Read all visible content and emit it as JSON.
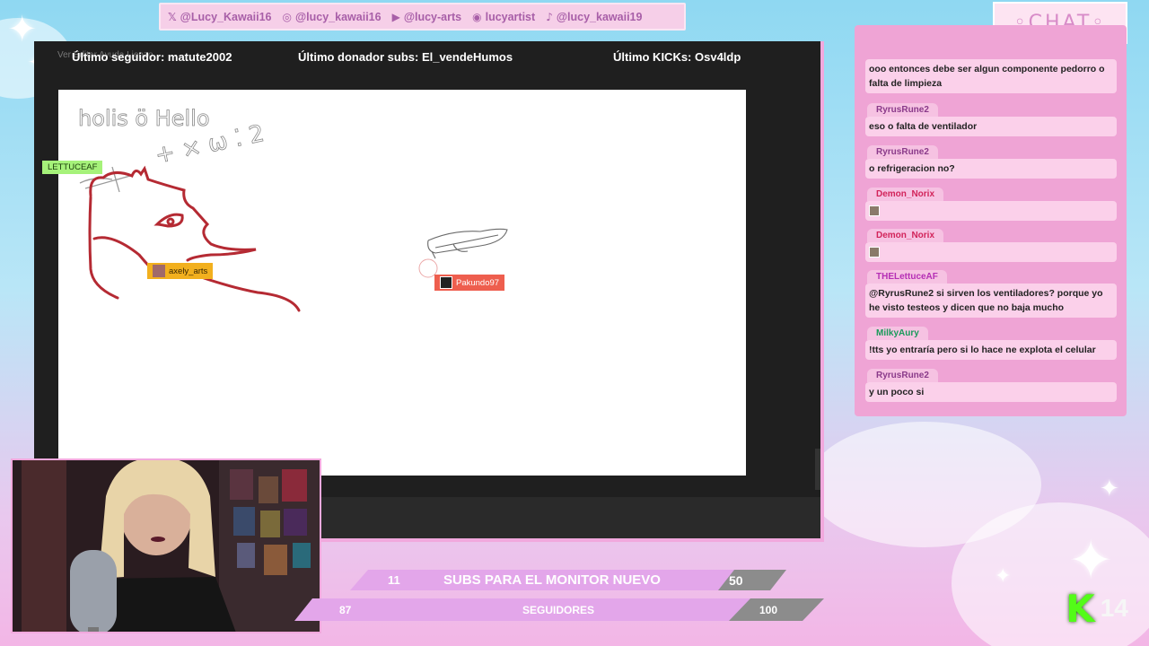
{
  "social": [
    {
      "icon": "x-icon",
      "glyph": "𝕏",
      "label": "@Lucy_Kawaii16"
    },
    {
      "icon": "instagram-icon",
      "glyph": "◎",
      "label": "@lucy_kawaii16"
    },
    {
      "icon": "youtube-icon",
      "glyph": "▶",
      "label": "@lucy-arts"
    },
    {
      "icon": "discord-icon",
      "glyph": "◉",
      "label": "lucyartist"
    },
    {
      "icon": "tiktok-icon",
      "glyph": "♪",
      "label": "@lucy_kawaii19"
    }
  ],
  "topbar": {
    "ghost_menu": "Ver   Editar   Ayuda   Lienzo",
    "follower": "Último seguidor: matute2002",
    "donor": "Último donador subs: El_vendeHumos",
    "kicks": "Último KICKs: Osv4ldp"
  },
  "canvas": {
    "handwriting_1": "holis ö   Hello",
    "handwriting_2": "+ × ω ⁚ 2",
    "cursors": [
      {
        "name": "LETTUCEAF",
        "color": "#a6f27a",
        "text_color": "#1a3d0a"
      },
      {
        "name": "axely_arts",
        "color": "#f2b01e",
        "text_color": "#3a2600"
      },
      {
        "name": "Pakundo97",
        "color": "#ee5e4e",
        "text_color": "#ffffff"
      }
    ]
  },
  "chat": {
    "title": "◦CHAT◦",
    "messages": [
      {
        "user": "",
        "text": "ooo entonces debe ser algun componente pedorro o falta de limpieza",
        "user_color": "#8a3a8a"
      },
      {
        "user": "RyrusRune2",
        "text": "eso o falta de ventilador",
        "user_color": "#8a3a8a"
      },
      {
        "user": "RyrusRune2",
        "text": "o refrigeracion no?",
        "user_color": "#8a3a8a"
      },
      {
        "user": "Demon_Norix",
        "text": "",
        "user_color": "#d2235a",
        "emote": true
      },
      {
        "user": "Demon_Norix",
        "text": "",
        "user_color": "#d2235a",
        "emote": true
      },
      {
        "user": "THELettuceAF",
        "text": "@RyrusRune2 si sirven los ventiladores? porque yo he visto testeos y dicen que no baja mucho",
        "user_color": "#b52fb5"
      },
      {
        "user": "MilkyAury",
        "text": "!tts yo entraría pero si lo hace ne explota el celular",
        "user_color": "#1a9a5a"
      },
      {
        "user": "RyrusRune2",
        "text": "y un poco si",
        "user_color": "#8a3a8a"
      }
    ]
  },
  "goals": {
    "subs": {
      "current": "11",
      "label": "SUBS PARA EL MONITOR NUEVO",
      "target": "50"
    },
    "followers": {
      "current": "87",
      "label": "SEGUIDORES",
      "target": "100"
    }
  },
  "kick": {
    "count": "14",
    "logo_letter": "K"
  },
  "colors": {
    "accent_pink": "#f1a8dd",
    "goal_pink": "#e3a6ea",
    "kick_green": "#53fc18"
  }
}
